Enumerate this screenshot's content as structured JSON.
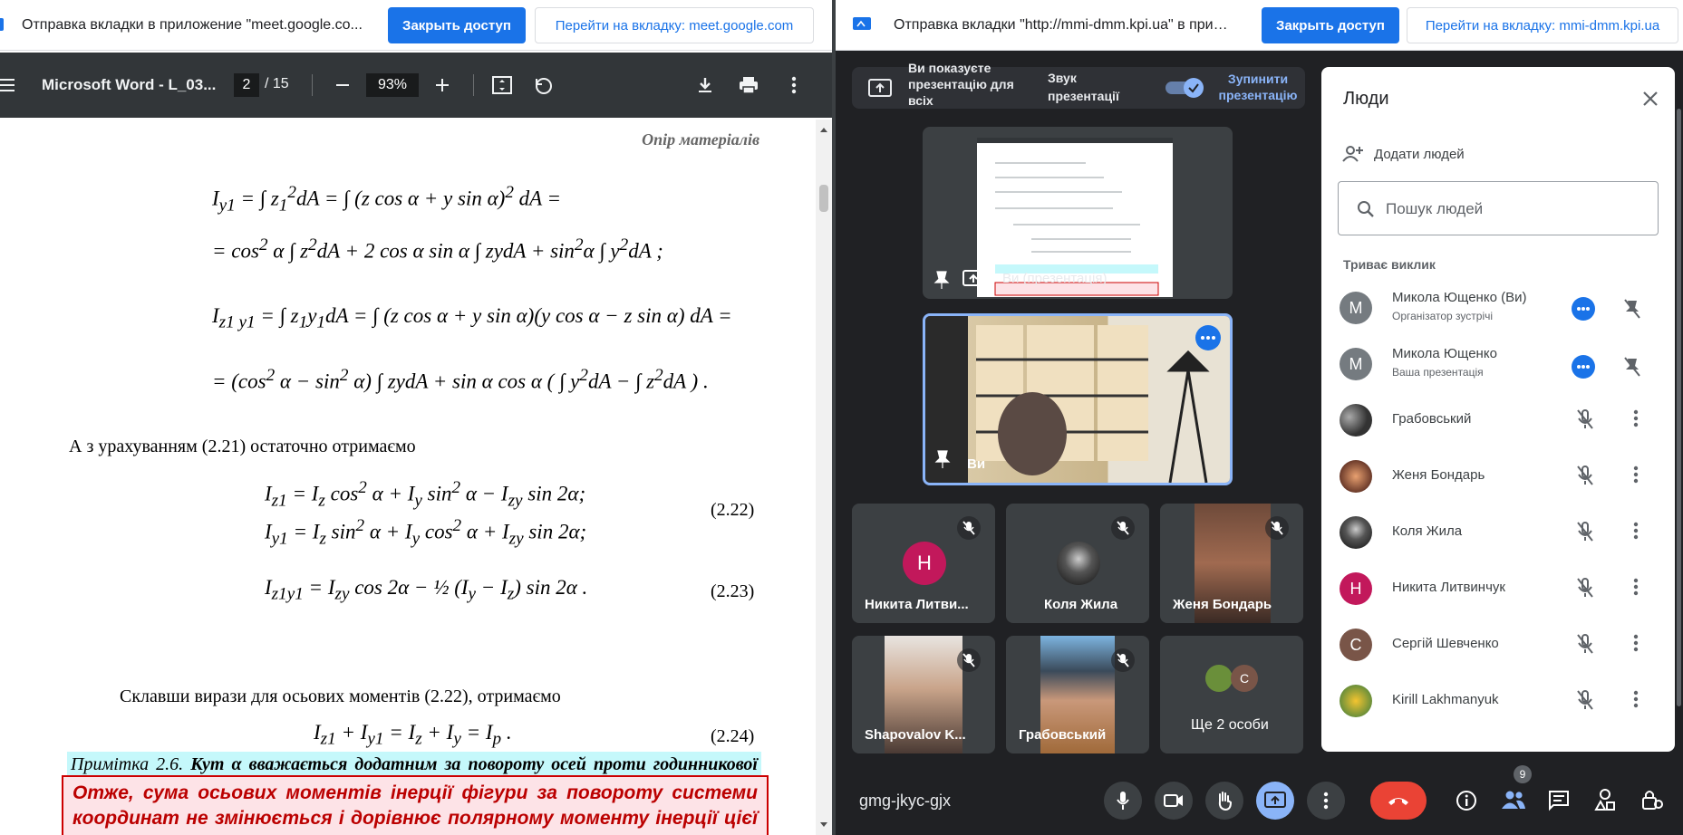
{
  "left_share_bar": {
    "message": "Отправка вкладки в приложение \"meet.google.co...",
    "stop_button": "Закрыть доступ",
    "go_button": "Перейти на вкладку: meet.google.com"
  },
  "right_share_bar": {
    "message": "Отправка вкладки \"http://mmi-dmm.kpi.ua\" в прил...",
    "stop_button": "Закрыть доступ",
    "go_button": "Перейти на вкладку: mmi-dmm.kpi.ua"
  },
  "pdf_viewer": {
    "title": "Microsoft Word - L_03...",
    "page_current": "2",
    "page_total": "/ 15",
    "zoom": "93%"
  },
  "document": {
    "header": "Опір матеріалів",
    "text1": "А з урахуванням (2.21) остаточно отримаємо",
    "eq_2_22": "(2.22)",
    "eq_2_23": "(2.23)",
    "note_label": "Примітка 2.6.",
    "note_text": " Кут  α  вважається додатним за повороту осей проти годинникової стрілки.",
    "text2": "Склавши вирази для осьових моментів (2.22), отримаємо",
    "eq_2_24": "(2.24)",
    "conclusion": "Отже, сума осьових моментів інерції фігури за повороту системи координат не змінюється і дорівнює полярному моменту інерції цієї фігури відносно початку координат."
  },
  "meet": {
    "banner_text": "Ви показуєте презентацію для всіх",
    "audio_label": "Звук презентації",
    "stop_label": "Зупинити презентацію",
    "presentation_tile_name": "Ви (презентація)",
    "self_tile_name": "Ви",
    "tiles": [
      {
        "name": "Никита Литви...",
        "initial": "Н",
        "color": "#c2185b"
      },
      {
        "name": "Коля Жила"
      },
      {
        "name": "Женя Бондарь"
      },
      {
        "name": "Shapovalov K..."
      },
      {
        "name": "Грабовський"
      },
      {
        "name": "Ще 2 особи",
        "initial": "С"
      }
    ],
    "meeting_code": "gmg-jkyc-gjx",
    "participants_badge": "9"
  },
  "people_panel": {
    "title": "Люди",
    "add_people": "Додати людей",
    "search_placeholder": "Пошук людей",
    "section": "Триває виклик",
    "people": [
      {
        "name": "Микола Ющенко (Ви)",
        "sub": "Організатор зустрічі",
        "initial": "М",
        "color": "#757b80"
      },
      {
        "name": "Микола Ющенко",
        "sub": "Ваша презентація",
        "initial": "М",
        "color": "#757b80"
      },
      {
        "name": "Грабовський",
        "sub": "",
        "initial": "",
        "color": "#4a4f55"
      },
      {
        "name": "Женя Бондарь",
        "sub": "",
        "initial": "",
        "color": "#6b3a2a"
      },
      {
        "name": "Коля Жила",
        "sub": "",
        "initial": "",
        "color": "#2c2c2c"
      },
      {
        "name": "Никита Литвинчук",
        "sub": "",
        "initial": "Н",
        "color": "#c2185b"
      },
      {
        "name": "Сергій Шевченко",
        "sub": "",
        "initial": "С",
        "color": "#795548"
      },
      {
        "name": "Kirill Lakhmanyuk",
        "sub": "",
        "initial": "",
        "color": "#6a8f3a"
      }
    ]
  },
  "colors": {
    "accent": "#1a73e8",
    "meet_bg": "#202124",
    "end_call": "#ea4335"
  }
}
